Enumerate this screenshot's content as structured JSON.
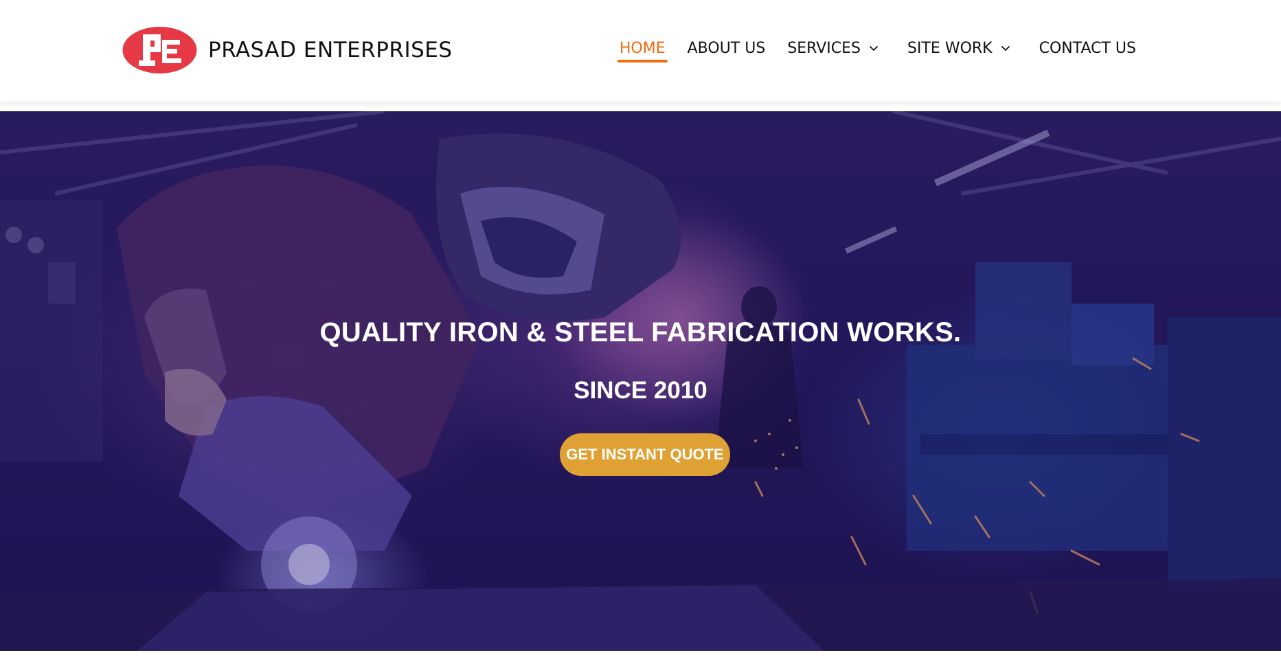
{
  "brand": {
    "logo_letters": "PE",
    "name": "PRASAD ENTERPRISES",
    "logo_color": "#e63946"
  },
  "nav": {
    "items": [
      {
        "label": "HOME",
        "active": true
      },
      {
        "label": "ABOUT US"
      },
      {
        "label": "SERVICES",
        "dropdown": true,
        "icon": "chevron-down-icon"
      },
      {
        "label": "SITE WORK",
        "dropdown": true,
        "icon": "chevron-down-icon"
      },
      {
        "label": "CONTACT US"
      }
    ],
    "active_color": "#f26b0f"
  },
  "hero": {
    "title": "QUALITY IRON & STEEL FABRICATION WORKS.",
    "subtitle": "SINCE 2010",
    "cta_label": "GET INSTANT QUOTE",
    "cta_color": "#e0a134",
    "overlay_color": "#2a1b57"
  }
}
